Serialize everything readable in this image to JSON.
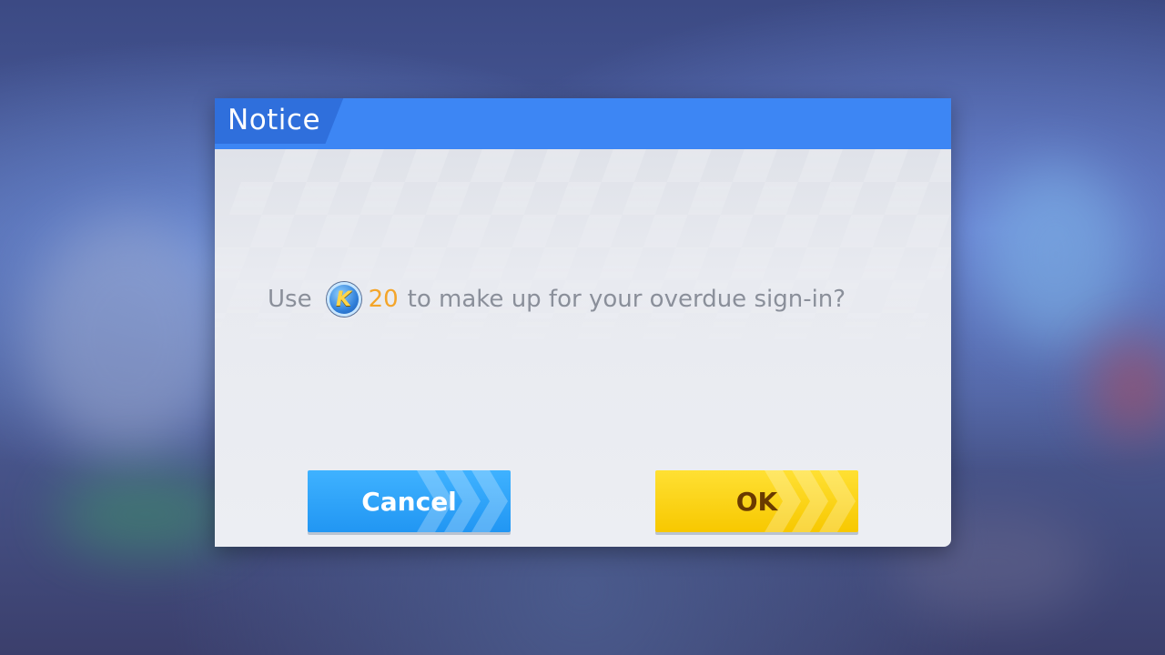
{
  "dialog": {
    "title": "Notice",
    "message": {
      "prefix": "Use",
      "currency_icon": "k-coin-icon",
      "currency_letter": "K",
      "amount": "20",
      "suffix": "to make up for your overdue sign-in?"
    },
    "buttons": {
      "cancel_label": "Cancel",
      "ok_label": "OK"
    }
  },
  "colors": {
    "header": "#3d86f4",
    "cancel_button": "#2196f3",
    "ok_button": "#f7c800",
    "amount": "#f4a52a"
  }
}
